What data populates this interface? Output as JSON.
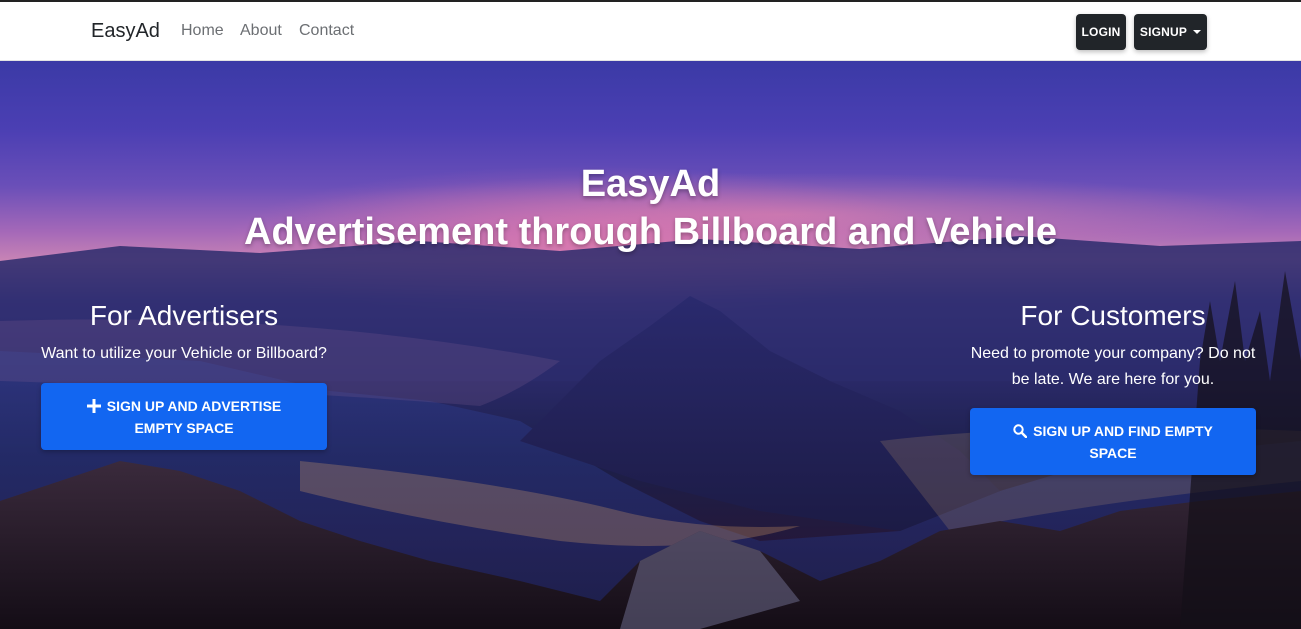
{
  "navbar": {
    "brand": "EasyAd",
    "links": [
      "Home",
      "About",
      "Contact"
    ],
    "login_label": "LOGIN",
    "signup_label": "SIGNUP"
  },
  "hero": {
    "title_line1": "EasyAd",
    "title_line2": "Advertisement through Billboard and Vehicle",
    "advertisers": {
      "heading": "For Advertisers",
      "text": "Want to utilize your Vehicle or Billboard?",
      "button_label": "SIGN UP AND ADVERTISE EMPTY SPACE",
      "button_icon": "plus-icon"
    },
    "customers": {
      "heading": "For Customers",
      "text": "Need to promote your company? Do not be late. We are here for you.",
      "button_label": "SIGN UP AND FIND EMPTY SPACE",
      "button_icon": "search-icon"
    }
  },
  "colors": {
    "primary": "#1266f1",
    "dark_button": "#212529"
  }
}
